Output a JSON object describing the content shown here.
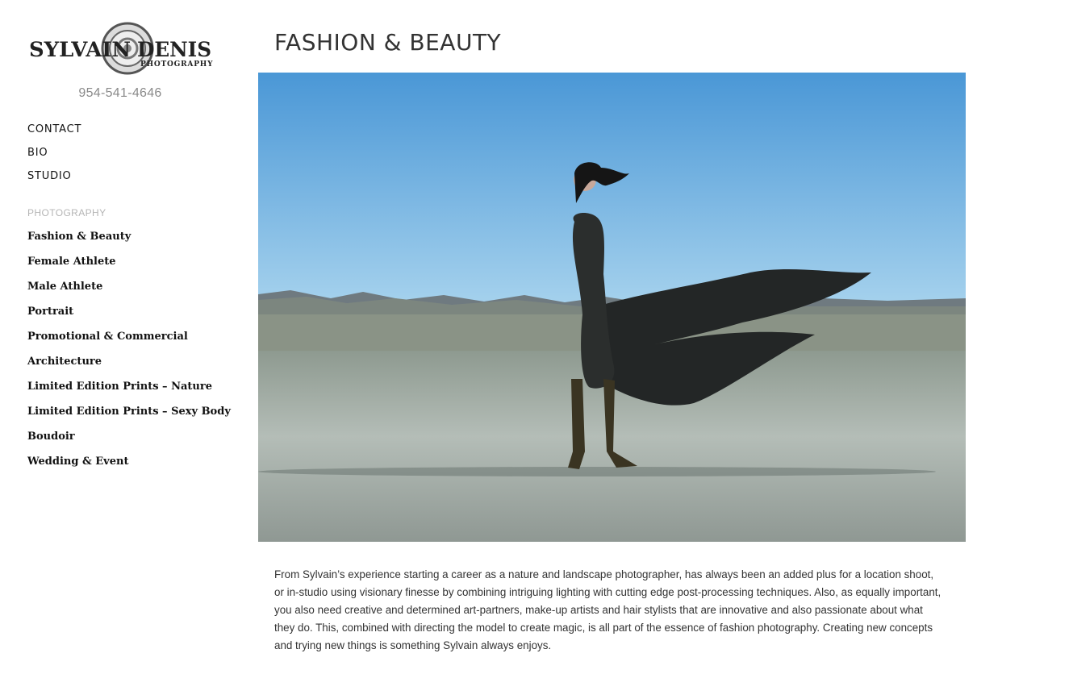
{
  "logo": {
    "name_first": "SYLVAIN",
    "name_last": "DENIS",
    "sub": "PHOTOGRAPHY",
    "lens_text": "SYLVAIN DENIS"
  },
  "phone": "954-541-4646",
  "top_nav": [
    "CONTACT",
    "BIO",
    "STUDIO"
  ],
  "section_heading": "PHOTOGRAPHY",
  "gallery_nav": [
    "Fashion & Beauty",
    "Female Athlete",
    "Male Athlete",
    "Portrait",
    "Promotional & Commercial",
    "Architecture",
    "Limited Edition Prints – Nature",
    "Limited Edition Prints – Sexy Body",
    "Boudoir",
    "Wedding & Event"
  ],
  "page_title": "FASHION & BEAUTY",
  "description": "From Sylvain’s experience starting a career as a nature and landscape photographer, has always been an added plus for a location shoot, or in-studio using visionary finesse by combining intriguing lighting with cutting edge post-processing techniques. Also, as equally important, you also need creative and determined art-partners, make-up artists and hair stylists that are innovative and also passionate about what they do. This, combined with directing the model to create magic, is all part of the essence of fashion photography. Creating new concepts and trying new things is something Sylvain always enjoys.",
  "colors": {
    "sky_top": "#4a97d6",
    "sky_bottom": "#a9d4ee",
    "ground": "#9aa49f",
    "nav_text": "#111111",
    "muted": "#b5b5b5"
  }
}
